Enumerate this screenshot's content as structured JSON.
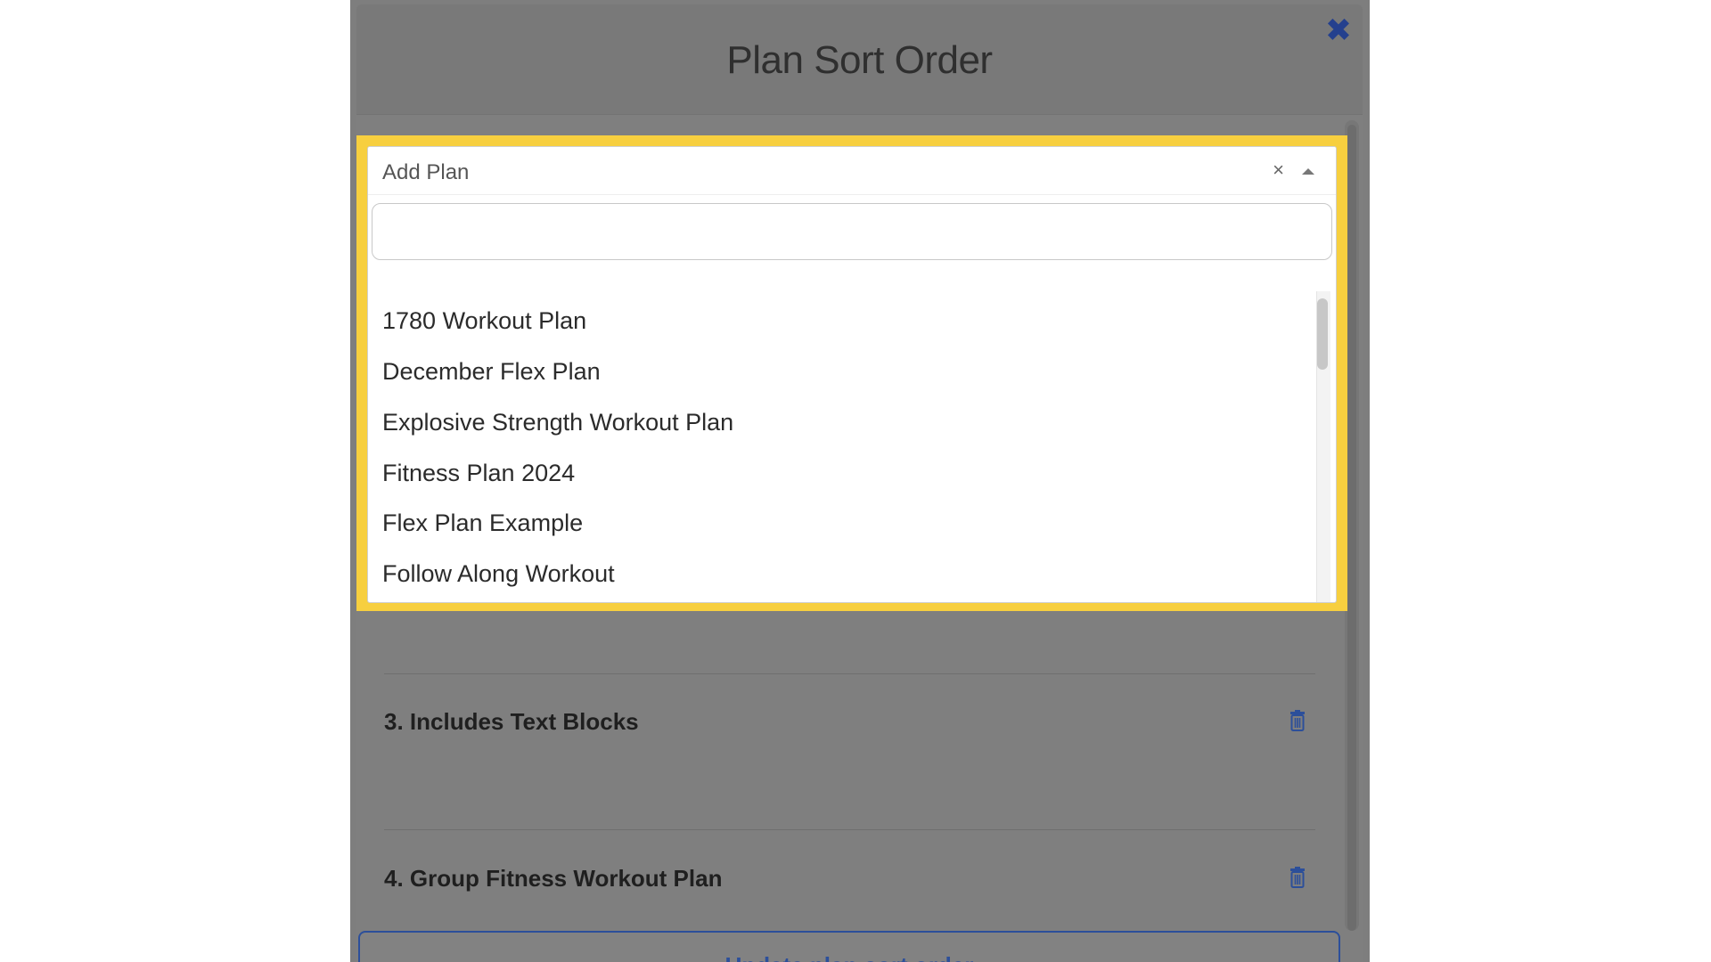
{
  "modal": {
    "title": "Plan Sort Order",
    "close_label": "✖"
  },
  "select": {
    "placeholder": "Add Plan",
    "clear_label": "×",
    "search_value": "",
    "options": [
      "1780 Workout Plan",
      "December Flex Plan",
      "Explosive Strength Workout Plan",
      "Fitness Plan 2024",
      "Flex Plan Example",
      "Follow Along Workout"
    ]
  },
  "plans": [
    {
      "label": "3. Includes Text Blocks"
    },
    {
      "label": "4. Group Fitness Workout Plan"
    }
  ],
  "footer": {
    "update_button": "Update plan sort order"
  },
  "colors": {
    "accent": "#2c4f9a",
    "highlight": "#f7cf3f",
    "overlay": "#7f7f7f"
  }
}
